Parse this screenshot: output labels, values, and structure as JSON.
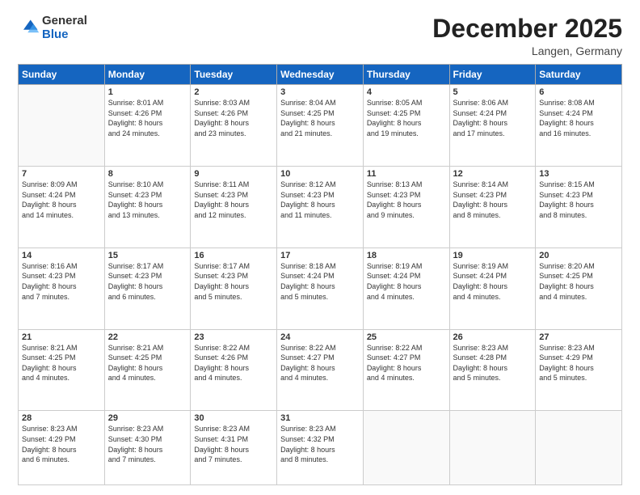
{
  "header": {
    "logo_general": "General",
    "logo_blue": "Blue",
    "month_title": "December 2025",
    "location": "Langen, Germany"
  },
  "days_of_week": [
    "Sunday",
    "Monday",
    "Tuesday",
    "Wednesday",
    "Thursday",
    "Friday",
    "Saturday"
  ],
  "weeks": [
    [
      {
        "day": "",
        "info": ""
      },
      {
        "day": "1",
        "info": "Sunrise: 8:01 AM\nSunset: 4:26 PM\nDaylight: 8 hours\nand 24 minutes."
      },
      {
        "day": "2",
        "info": "Sunrise: 8:03 AM\nSunset: 4:26 PM\nDaylight: 8 hours\nand 23 minutes."
      },
      {
        "day": "3",
        "info": "Sunrise: 8:04 AM\nSunset: 4:25 PM\nDaylight: 8 hours\nand 21 minutes."
      },
      {
        "day": "4",
        "info": "Sunrise: 8:05 AM\nSunset: 4:25 PM\nDaylight: 8 hours\nand 19 minutes."
      },
      {
        "day": "5",
        "info": "Sunrise: 8:06 AM\nSunset: 4:24 PM\nDaylight: 8 hours\nand 17 minutes."
      },
      {
        "day": "6",
        "info": "Sunrise: 8:08 AM\nSunset: 4:24 PM\nDaylight: 8 hours\nand 16 minutes."
      }
    ],
    [
      {
        "day": "7",
        "info": "Sunrise: 8:09 AM\nSunset: 4:24 PM\nDaylight: 8 hours\nand 14 minutes."
      },
      {
        "day": "8",
        "info": "Sunrise: 8:10 AM\nSunset: 4:23 PM\nDaylight: 8 hours\nand 13 minutes."
      },
      {
        "day": "9",
        "info": "Sunrise: 8:11 AM\nSunset: 4:23 PM\nDaylight: 8 hours\nand 12 minutes."
      },
      {
        "day": "10",
        "info": "Sunrise: 8:12 AM\nSunset: 4:23 PM\nDaylight: 8 hours\nand 11 minutes."
      },
      {
        "day": "11",
        "info": "Sunrise: 8:13 AM\nSunset: 4:23 PM\nDaylight: 8 hours\nand 9 minutes."
      },
      {
        "day": "12",
        "info": "Sunrise: 8:14 AM\nSunset: 4:23 PM\nDaylight: 8 hours\nand 8 minutes."
      },
      {
        "day": "13",
        "info": "Sunrise: 8:15 AM\nSunset: 4:23 PM\nDaylight: 8 hours\nand 8 minutes."
      }
    ],
    [
      {
        "day": "14",
        "info": "Sunrise: 8:16 AM\nSunset: 4:23 PM\nDaylight: 8 hours\nand 7 minutes."
      },
      {
        "day": "15",
        "info": "Sunrise: 8:17 AM\nSunset: 4:23 PM\nDaylight: 8 hours\nand 6 minutes."
      },
      {
        "day": "16",
        "info": "Sunrise: 8:17 AM\nSunset: 4:23 PM\nDaylight: 8 hours\nand 5 minutes."
      },
      {
        "day": "17",
        "info": "Sunrise: 8:18 AM\nSunset: 4:24 PM\nDaylight: 8 hours\nand 5 minutes."
      },
      {
        "day": "18",
        "info": "Sunrise: 8:19 AM\nSunset: 4:24 PM\nDaylight: 8 hours\nand 4 minutes."
      },
      {
        "day": "19",
        "info": "Sunrise: 8:19 AM\nSunset: 4:24 PM\nDaylight: 8 hours\nand 4 minutes."
      },
      {
        "day": "20",
        "info": "Sunrise: 8:20 AM\nSunset: 4:25 PM\nDaylight: 8 hours\nand 4 minutes."
      }
    ],
    [
      {
        "day": "21",
        "info": "Sunrise: 8:21 AM\nSunset: 4:25 PM\nDaylight: 8 hours\nand 4 minutes."
      },
      {
        "day": "22",
        "info": "Sunrise: 8:21 AM\nSunset: 4:25 PM\nDaylight: 8 hours\nand 4 minutes."
      },
      {
        "day": "23",
        "info": "Sunrise: 8:22 AM\nSunset: 4:26 PM\nDaylight: 8 hours\nand 4 minutes."
      },
      {
        "day": "24",
        "info": "Sunrise: 8:22 AM\nSunset: 4:27 PM\nDaylight: 8 hours\nand 4 minutes."
      },
      {
        "day": "25",
        "info": "Sunrise: 8:22 AM\nSunset: 4:27 PM\nDaylight: 8 hours\nand 4 minutes."
      },
      {
        "day": "26",
        "info": "Sunrise: 8:23 AM\nSunset: 4:28 PM\nDaylight: 8 hours\nand 5 minutes."
      },
      {
        "day": "27",
        "info": "Sunrise: 8:23 AM\nSunset: 4:29 PM\nDaylight: 8 hours\nand 5 minutes."
      }
    ],
    [
      {
        "day": "28",
        "info": "Sunrise: 8:23 AM\nSunset: 4:29 PM\nDaylight: 8 hours\nand 6 minutes."
      },
      {
        "day": "29",
        "info": "Sunrise: 8:23 AM\nSunset: 4:30 PM\nDaylight: 8 hours\nand 7 minutes."
      },
      {
        "day": "30",
        "info": "Sunrise: 8:23 AM\nSunset: 4:31 PM\nDaylight: 8 hours\nand 7 minutes."
      },
      {
        "day": "31",
        "info": "Sunrise: 8:23 AM\nSunset: 4:32 PM\nDaylight: 8 hours\nand 8 minutes."
      },
      {
        "day": "",
        "info": ""
      },
      {
        "day": "",
        "info": ""
      },
      {
        "day": "",
        "info": ""
      }
    ]
  ]
}
